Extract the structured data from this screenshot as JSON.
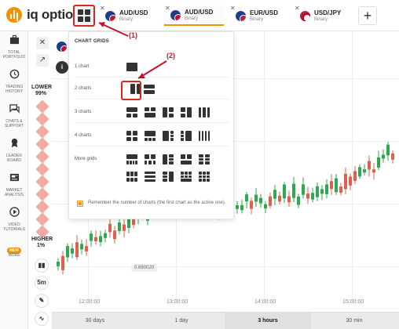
{
  "brand": {
    "name": "iq option"
  },
  "tabs": [
    {
      "pair": "AUD/USD",
      "type": "Binary",
      "flag": "au",
      "active": false
    },
    {
      "pair": "AUD/USD",
      "type": "Binary",
      "flag": "au",
      "active": true
    },
    {
      "pair": "EUR/USD",
      "type": "Binary",
      "flag": "eu",
      "active": false
    },
    {
      "pair": "USD/JPY",
      "type": "Binary",
      "flag": "us",
      "active": false
    }
  ],
  "add_tab_label": "+",
  "sidebar": {
    "items": [
      {
        "label": "TOTAL PORTFOLIO",
        "icon": "briefcase-icon"
      },
      {
        "label": "TRADING HISTORY",
        "icon": "history-icon"
      },
      {
        "label": "CHATS & SUPPORT",
        "icon": "chat-icon"
      },
      {
        "label": "LEADER BOARD",
        "icon": "trophy-icon"
      },
      {
        "label": "MARKET ANALYSIS",
        "icon": "news-icon"
      },
      {
        "label": "VIDEO TUTORIALS",
        "icon": "play-icon"
      },
      {
        "label": "MORE",
        "icon": "more-icon",
        "badge": "NEW"
      }
    ]
  },
  "toolbar": {
    "candles_button": "5m"
  },
  "sentiment": {
    "lower_label": "LOWER",
    "lower_value": "99%",
    "higher_label": "HIGHER",
    "higher_value": "1%"
  },
  "price_tag": "0.690020",
  "time_labels": [
    "12:00:00",
    "13:00:00",
    "14:00:00",
    "15:00:00"
  ],
  "ranges": [
    {
      "label": "30 days",
      "active": false
    },
    {
      "label": "1 day",
      "active": false
    },
    {
      "label": "3 hours",
      "active": true
    },
    {
      "label": "30 min",
      "active": false
    }
  ],
  "panel": {
    "title": "CHART GRIDS",
    "rows": [
      {
        "label": "1 chart"
      },
      {
        "label": "2 charts"
      },
      {
        "label": "3 charts"
      },
      {
        "label": "4 charts"
      },
      {
        "label": "More grids"
      }
    ],
    "remember_text": "Remember the number of charts (the first chart as the active one)."
  },
  "annotations": {
    "callout_1": "(1)",
    "callout_2": "(2)"
  },
  "colors": {
    "accent": "#f39200",
    "highlight": "#d9261c",
    "candle_up": "#2fa84f",
    "candle_down": "#e0604f"
  }
}
